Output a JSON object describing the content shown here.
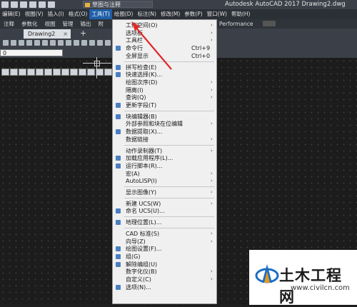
{
  "app": {
    "title": "Autodesk AutoCAD 2017    Drawing2.dwg",
    "workspace": "草图与注释"
  },
  "menubar": {
    "items": [
      {
        "label": "编辑(E)"
      },
      {
        "label": "视图(V)"
      },
      {
        "label": "插入(I)"
      },
      {
        "label": "格式(O)"
      },
      {
        "label": "工具(T)",
        "active": true
      },
      {
        "label": "绘图(D)"
      },
      {
        "label": "标注(N)"
      },
      {
        "label": "修改(M)"
      },
      {
        "label": "参数(P)"
      },
      {
        "label": "窗口(W)"
      },
      {
        "label": "帮助(H)"
      }
    ]
  },
  "ribbon": {
    "tabs": [
      "注释",
      "参数化",
      "视图",
      "管理",
      "输出",
      "附"
    ],
    "extra": "Performance"
  },
  "doc": {
    "tab": "Drawing2",
    "close": "×",
    "new": "+"
  },
  "layer_combo": "0",
  "tools_menu": {
    "items": [
      {
        "label": "工作空间(O)",
        "shortcut": "",
        "submenu": true,
        "icon": ""
      },
      {
        "label": "选项板",
        "shortcut": "",
        "submenu": true,
        "icon": ""
      },
      {
        "label": "工具栏",
        "shortcut": "",
        "submenu": true,
        "icon": ""
      },
      {
        "label": "命令行",
        "shortcut": "Ctrl+9",
        "submenu": false,
        "icon": "command-line-icon"
      },
      {
        "label": "全屏显示",
        "shortcut": "Ctrl+0",
        "submenu": false,
        "icon": ""
      },
      {
        "sep": true
      },
      {
        "label": "拼写检查(E)",
        "shortcut": "",
        "submenu": false,
        "icon": "spell-check-icon"
      },
      {
        "label": "快速选择(K)...",
        "shortcut": "",
        "submenu": false,
        "icon": "quick-select-icon"
      },
      {
        "label": "绘图次序(D)",
        "shortcut": "",
        "submenu": true,
        "icon": ""
      },
      {
        "label": "隔离(I)",
        "shortcut": "",
        "submenu": true,
        "icon": ""
      },
      {
        "label": "查询(Q)",
        "shortcut": "",
        "submenu": true,
        "icon": ""
      },
      {
        "label": "更新字段(T)",
        "shortcut": "",
        "submenu": false,
        "icon": "update-field-icon"
      },
      {
        "sep": true
      },
      {
        "label": "块编辑器(B)",
        "shortcut": "",
        "submenu": false,
        "icon": "block-editor-icon"
      },
      {
        "label": "外部参照和块在位编辑",
        "shortcut": "",
        "submenu": true,
        "icon": ""
      },
      {
        "label": "数据提取(X)...",
        "shortcut": "",
        "submenu": false,
        "icon": "data-extraction-icon"
      },
      {
        "label": "数据链接",
        "shortcut": "",
        "submenu": true,
        "icon": ""
      },
      {
        "sep": true
      },
      {
        "label": "动作录制器(T)",
        "shortcut": "",
        "submenu": true,
        "icon": ""
      },
      {
        "label": "加载应用程序(L)...",
        "shortcut": "",
        "submenu": false,
        "icon": "load-application-icon"
      },
      {
        "label": "运行脚本(R)...",
        "shortcut": "",
        "submenu": false,
        "icon": "run-script-icon"
      },
      {
        "label": "宏(A)",
        "shortcut": "",
        "submenu": true,
        "icon": ""
      },
      {
        "label": "AutoLISP(I)",
        "shortcut": "",
        "submenu": true,
        "icon": ""
      },
      {
        "sep": true
      },
      {
        "label": "显示图像(Y)",
        "shortcut": "",
        "submenu": true,
        "icon": ""
      },
      {
        "sep": true
      },
      {
        "label": "新建 UCS(W)",
        "shortcut": "",
        "submenu": true,
        "icon": ""
      },
      {
        "label": "命名 UCS(U)...",
        "shortcut": "",
        "submenu": false,
        "icon": "named-ucs-icon"
      },
      {
        "sep": true
      },
      {
        "label": "地理位置(L)...",
        "shortcut": "",
        "submenu": false,
        "icon": "geolocation-icon"
      },
      {
        "sep": true
      },
      {
        "label": "CAD 标准(S)",
        "shortcut": "",
        "submenu": true,
        "icon": ""
      },
      {
        "label": "向导(Z)",
        "shortcut": "",
        "submenu": true,
        "icon": ""
      },
      {
        "label": "绘图设置(F)...",
        "shortcut": "",
        "submenu": false,
        "icon": "drafting-settings-icon"
      },
      {
        "label": "组(G)",
        "shortcut": "",
        "submenu": false,
        "icon": "group-icon"
      },
      {
        "label": "解除编组(U)",
        "shortcut": "",
        "submenu": false,
        "icon": "ungroup-icon"
      },
      {
        "label": "数字化仪(B)",
        "shortcut": "",
        "submenu": true,
        "icon": ""
      },
      {
        "label": "自定义(C)",
        "shortcut": "",
        "submenu": true,
        "icon": ""
      },
      {
        "label": "选项(N)...",
        "shortcut": "",
        "submenu": false,
        "icon": "options-icon"
      }
    ]
  },
  "watermark": {
    "title": "土木工程网",
    "url": "www.civilcn.com"
  },
  "colors": {
    "active_menu": "#1f5fa8",
    "arrow": "#e0282a",
    "canvas": "#1c1c1c"
  }
}
